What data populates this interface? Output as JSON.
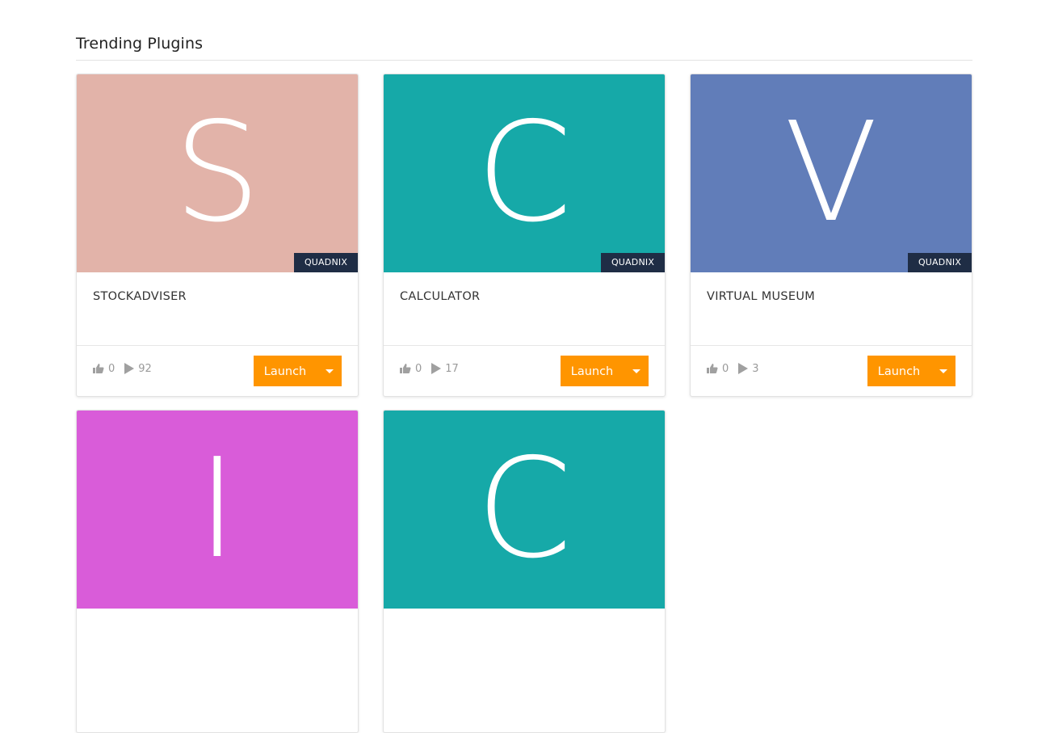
{
  "section": {
    "title": "Trending Plugins"
  },
  "cards": [
    {
      "letter": "S",
      "color": "#e2b3a9",
      "publisher": "QUADNIX",
      "name": "STOCKADVISER",
      "likes": "0",
      "plays": "92",
      "launch_label": "Launch"
    },
    {
      "letter": "C",
      "color": "#16a9a8",
      "publisher": "QUADNIX",
      "name": "CALCULATOR",
      "likes": "0",
      "plays": "17",
      "launch_label": "Launch"
    },
    {
      "letter": "V",
      "color": "#617db9",
      "publisher": "QUADNIX",
      "name": "VIRTUAL MUSEUM",
      "likes": "0",
      "plays": "3",
      "launch_label": "Launch"
    },
    {
      "letter": "I",
      "color": "#d95cd9"
    },
    {
      "letter": "C",
      "color": "#16a9a8"
    }
  ],
  "theme": {
    "accent": "#ff9500",
    "badge": "#1f2d45"
  }
}
